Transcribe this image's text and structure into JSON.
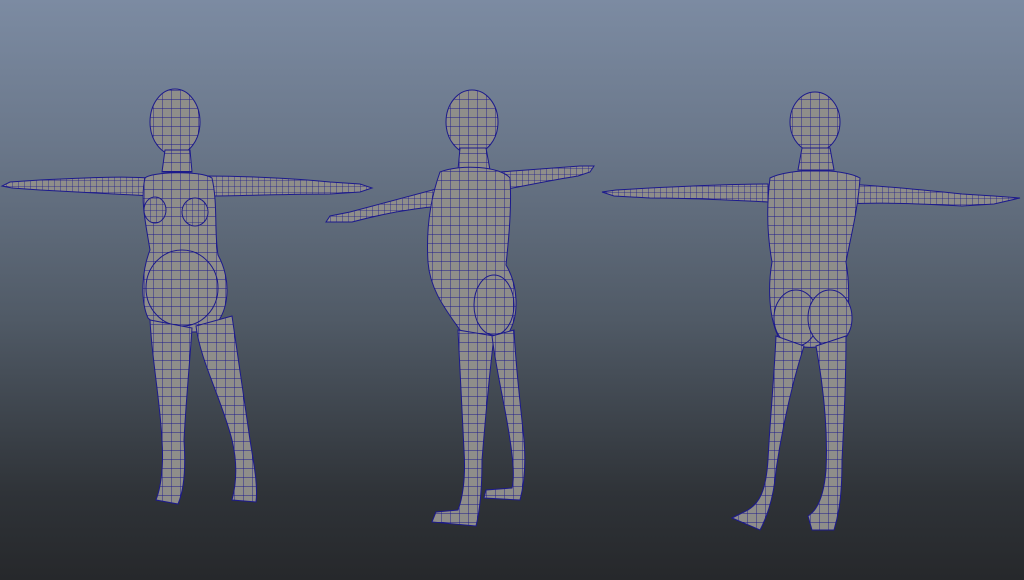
{
  "viewport": {
    "background_top": "#7c8ba2",
    "background_bottom": "#26282b",
    "mesh_fill": "#8f8e8a",
    "wireframe_color": "#1c1a8c"
  },
  "models": [
    {
      "view": "front-three-quarter",
      "pose": "t-pose"
    },
    {
      "view": "side-back-three-quarter",
      "pose": "t-pose"
    },
    {
      "view": "back",
      "pose": "t-pose"
    }
  ]
}
